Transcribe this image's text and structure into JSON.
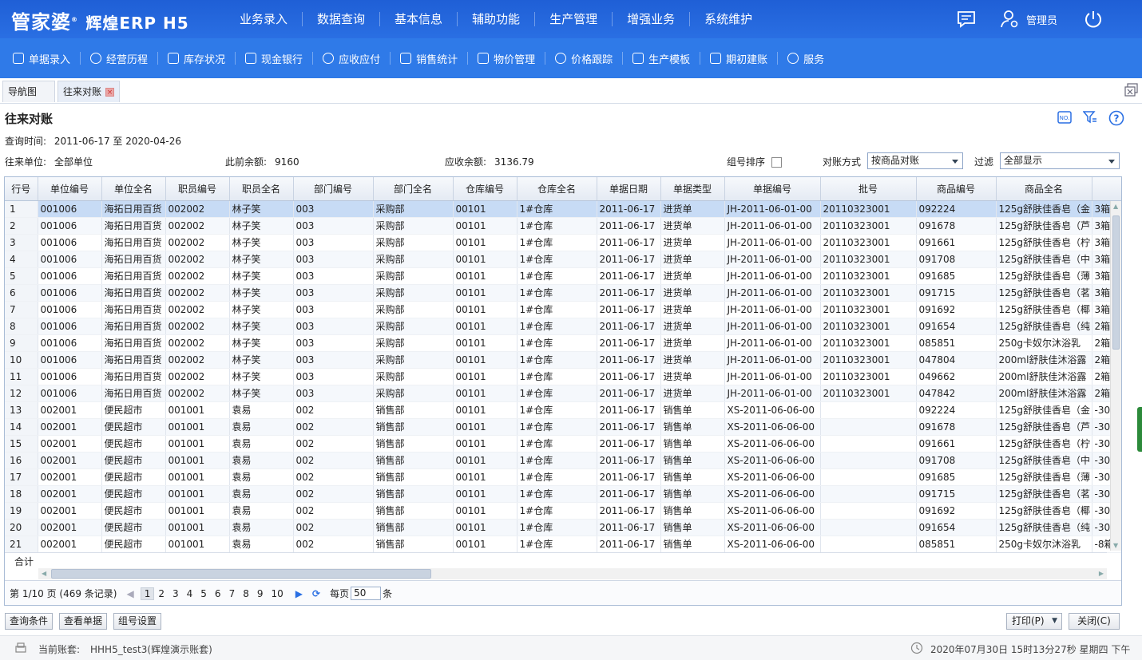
{
  "app": {
    "logo_main": "管家婆",
    "logo_sub": "辉煌ERP H5",
    "main_nav": [
      "业务录入",
      "数据查询",
      "基本信息",
      "辅助功能",
      "生产管理",
      "增强业务",
      "系统维护"
    ],
    "user": "管理员"
  },
  "toolbar": [
    "单据录入",
    "经营历程",
    "库存状况",
    "现金银行",
    "应收应付",
    "销售统计",
    "物价管理",
    "价格跟踪",
    "生产模板",
    "期初建账",
    "服务"
  ],
  "tabs": {
    "nav": "导航图",
    "active": "往来对账"
  },
  "page": {
    "title": "往来对账",
    "query_time_label": "查询时间:",
    "query_time": "2011-06-17 至 2020-04-26",
    "unit_label": "往来单位:",
    "unit": "全部单位",
    "prev_balance_label": "此前余额:",
    "prev_balance": "9160",
    "receivable_label": "应收余额:",
    "receivable": "3136.79",
    "group_sort_label": "组号排序",
    "mode_label": "对账方式",
    "mode_value": "按商品对账",
    "filter_label": "过滤",
    "filter_value": "全部显示"
  },
  "grid": {
    "columns": [
      "行号",
      "单位编号",
      "单位全名",
      "职员编号",
      "职员全名",
      "部门编号",
      "部门全名",
      "仓库编号",
      "仓库全名",
      "单据日期",
      "单据类型",
      "单据编号",
      "批号",
      "商品编号",
      "商品全名",
      ""
    ],
    "rows": [
      [
        "1",
        "001006",
        "海拓日用百货",
        "002002",
        "林子笑",
        "003",
        "采购部",
        "00101",
        "1#仓库",
        "2011-06-17",
        "进货单",
        "JH-2011-06-01-00",
        "20110323001",
        "092224",
        "125g舒肤佳香皂（金",
        "3箱"
      ],
      [
        "2",
        "001006",
        "海拓日用百货",
        "002002",
        "林子笑",
        "003",
        "采购部",
        "00101",
        "1#仓库",
        "2011-06-17",
        "进货单",
        "JH-2011-06-01-00",
        "20110323001",
        "091678",
        "125g舒肤佳香皂（芦",
        "3箱"
      ],
      [
        "3",
        "001006",
        "海拓日用百货",
        "002002",
        "林子笑",
        "003",
        "采购部",
        "00101",
        "1#仓库",
        "2011-06-17",
        "进货单",
        "JH-2011-06-01-00",
        "20110323001",
        "091661",
        "125g舒肤佳香皂（柠",
        "3箱"
      ],
      [
        "4",
        "001006",
        "海拓日用百货",
        "002002",
        "林子笑",
        "003",
        "采购部",
        "00101",
        "1#仓库",
        "2011-06-17",
        "进货单",
        "JH-2011-06-01-00",
        "20110323001",
        "091708",
        "125g舒肤佳香皂（中",
        "3箱"
      ],
      [
        "5",
        "001006",
        "海拓日用百货",
        "002002",
        "林子笑",
        "003",
        "采购部",
        "00101",
        "1#仓库",
        "2011-06-17",
        "进货单",
        "JH-2011-06-01-00",
        "20110323001",
        "091685",
        "125g舒肤佳香皂（薄",
        "3箱"
      ],
      [
        "6",
        "001006",
        "海拓日用百货",
        "002002",
        "林子笑",
        "003",
        "采购部",
        "00101",
        "1#仓库",
        "2011-06-17",
        "进货单",
        "JH-2011-06-01-00",
        "20110323001",
        "091715",
        "125g舒肤佳香皂（茗",
        "3箱"
      ],
      [
        "7",
        "001006",
        "海拓日用百货",
        "002002",
        "林子笑",
        "003",
        "采购部",
        "00101",
        "1#仓库",
        "2011-06-17",
        "进货单",
        "JH-2011-06-01-00",
        "20110323001",
        "091692",
        "125g舒肤佳香皂（椰",
        "3箱"
      ],
      [
        "8",
        "001006",
        "海拓日用百货",
        "002002",
        "林子笑",
        "003",
        "采购部",
        "00101",
        "1#仓库",
        "2011-06-17",
        "进货单",
        "JH-2011-06-01-00",
        "20110323001",
        "091654",
        "125g舒肤佳香皂（纯",
        "2箱"
      ],
      [
        "9",
        "001006",
        "海拓日用百货",
        "002002",
        "林子笑",
        "003",
        "采购部",
        "00101",
        "1#仓库",
        "2011-06-17",
        "进货单",
        "JH-2011-06-01-00",
        "20110323001",
        "085851",
        "250g卡奴尔沐浴乳",
        "2箱"
      ],
      [
        "10",
        "001006",
        "海拓日用百货",
        "002002",
        "林子笑",
        "003",
        "采购部",
        "00101",
        "1#仓库",
        "2011-06-17",
        "进货单",
        "JH-2011-06-01-00",
        "20110323001",
        "047804",
        "200ml舒肤佳沐浴露",
        "2箱"
      ],
      [
        "11",
        "001006",
        "海拓日用百货",
        "002002",
        "林子笑",
        "003",
        "采购部",
        "00101",
        "1#仓库",
        "2011-06-17",
        "进货单",
        "JH-2011-06-01-00",
        "20110323001",
        "049662",
        "200ml舒肤佳沐浴露",
        "2箱"
      ],
      [
        "12",
        "001006",
        "海拓日用百货",
        "002002",
        "林子笑",
        "003",
        "采购部",
        "00101",
        "1#仓库",
        "2011-06-17",
        "进货单",
        "JH-2011-06-01-00",
        "20110323001",
        "047842",
        "200ml舒肤佳沐浴露",
        "2箱"
      ],
      [
        "13",
        "002001",
        "便民超市",
        "001001",
        "袁易",
        "002",
        "销售部",
        "00101",
        "1#仓库",
        "2011-06-17",
        "销售单",
        "XS-2011-06-06-00",
        "",
        "092224",
        "125g舒肤佳香皂（金",
        "-30"
      ],
      [
        "14",
        "002001",
        "便民超市",
        "001001",
        "袁易",
        "002",
        "销售部",
        "00101",
        "1#仓库",
        "2011-06-17",
        "销售单",
        "XS-2011-06-06-00",
        "",
        "091678",
        "125g舒肤佳香皂（芦",
        "-30"
      ],
      [
        "15",
        "002001",
        "便民超市",
        "001001",
        "袁易",
        "002",
        "销售部",
        "00101",
        "1#仓库",
        "2011-06-17",
        "销售单",
        "XS-2011-06-06-00",
        "",
        "091661",
        "125g舒肤佳香皂（柠",
        "-30"
      ],
      [
        "16",
        "002001",
        "便民超市",
        "001001",
        "袁易",
        "002",
        "销售部",
        "00101",
        "1#仓库",
        "2011-06-17",
        "销售单",
        "XS-2011-06-06-00",
        "",
        "091708",
        "125g舒肤佳香皂（中",
        "-30"
      ],
      [
        "17",
        "002001",
        "便民超市",
        "001001",
        "袁易",
        "002",
        "销售部",
        "00101",
        "1#仓库",
        "2011-06-17",
        "销售单",
        "XS-2011-06-06-00",
        "",
        "091685",
        "125g舒肤佳香皂（薄",
        "-30"
      ],
      [
        "18",
        "002001",
        "便民超市",
        "001001",
        "袁易",
        "002",
        "销售部",
        "00101",
        "1#仓库",
        "2011-06-17",
        "销售单",
        "XS-2011-06-06-00",
        "",
        "091715",
        "125g舒肤佳香皂（茗",
        "-30"
      ],
      [
        "19",
        "002001",
        "便民超市",
        "001001",
        "袁易",
        "002",
        "销售部",
        "00101",
        "1#仓库",
        "2011-06-17",
        "销售单",
        "XS-2011-06-06-00",
        "",
        "091692",
        "125g舒肤佳香皂（椰",
        "-30"
      ],
      [
        "20",
        "002001",
        "便民超市",
        "001001",
        "袁易",
        "002",
        "销售部",
        "00101",
        "1#仓库",
        "2011-06-17",
        "销售单",
        "XS-2011-06-06-00",
        "",
        "091654",
        "125g舒肤佳香皂（纯",
        "-30"
      ],
      [
        "21",
        "002001",
        "便民超市",
        "001001",
        "袁易",
        "002",
        "销售部",
        "00101",
        "1#仓库",
        "2011-06-17",
        "销售单",
        "XS-2011-06-06-00",
        "",
        "085851",
        "250g卡奴尔沐浴乳",
        "-8箱"
      ]
    ],
    "total_label": "合计"
  },
  "pager": {
    "info": "第 1/10 页 (469 条记录)",
    "pages": [
      "1",
      "2",
      "3",
      "4",
      "5",
      "6",
      "7",
      "8",
      "9",
      "10"
    ],
    "per_page_label": "每页",
    "per_page": "50",
    "unit": "条"
  },
  "buttons": {
    "query": "查询条件",
    "view_doc": "查看单据",
    "group_settings": "组号设置",
    "print": "打印(P)",
    "close": "关闭(C)"
  },
  "status": {
    "account_label": "当前账套:",
    "account": "HHH5_test3(辉煌演示账套)",
    "datetime": "2020年07月30日 15时13分27秒 星期四 下午"
  }
}
